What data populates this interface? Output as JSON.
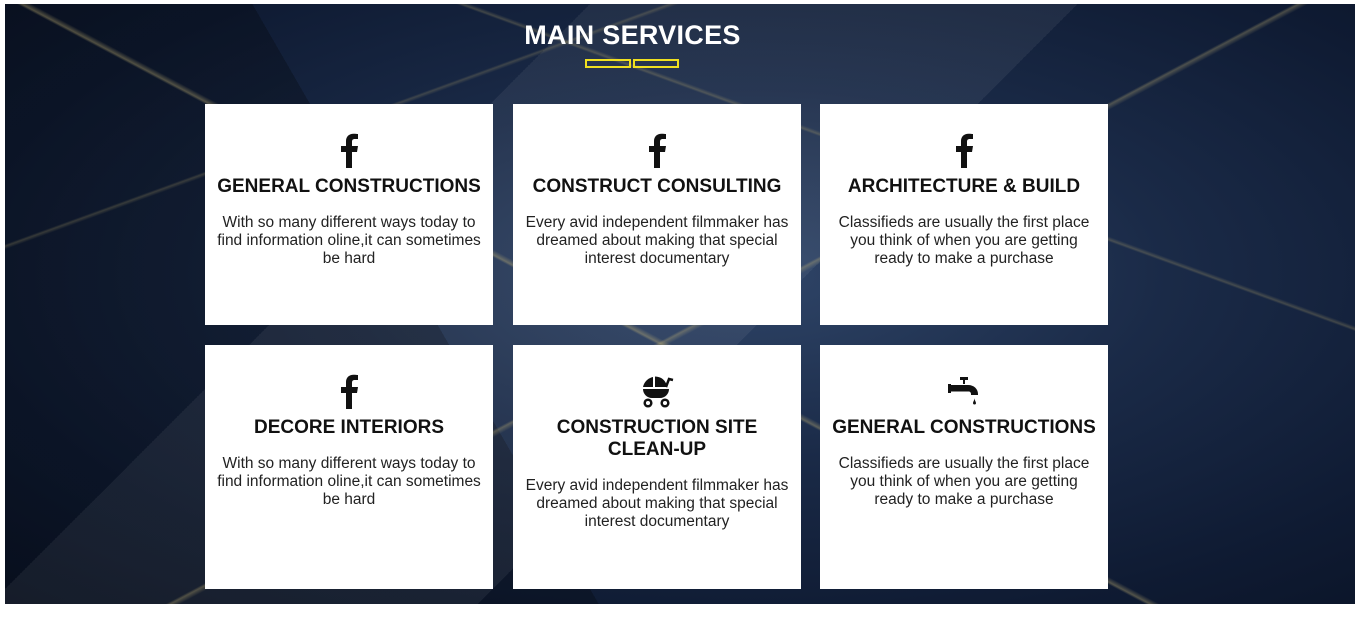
{
  "section": {
    "title": "MAIN SERVICES",
    "accent_color": "#f0e020"
  },
  "cards": [
    {
      "icon": "facebook-icon",
      "title": "GENERAL CONSTRUCTIONS",
      "text": "With so many different ways today to find information oline,it can sometimes be hard"
    },
    {
      "icon": "facebook-icon",
      "title": "CONSTRUCT CONSULTING",
      "text": "Every avid independent filmmaker has dreamed about making that special interest documentary"
    },
    {
      "icon": "facebook-icon",
      "title": "ARCHITECTURE & BUILD",
      "text": "Classifieds are usually the first place you think of when you are getting ready to make a purchase"
    },
    {
      "icon": "facebook-icon",
      "title": "DECORE INTERIORS",
      "text": "With so many different ways today to find information oline,it can sometimes be hard"
    },
    {
      "icon": "baby-carriage-icon",
      "title": "CONSTRUCTION SITE CLEAN-UP",
      "text": "Every avid independent filmmaker has dreamed about making that special interest documentary"
    },
    {
      "icon": "faucet-icon",
      "title": "GENERAL CONSTRUCTIONS",
      "text": "Classifieds are usually the first place you think of when you are getting ready to make a purchase"
    }
  ]
}
